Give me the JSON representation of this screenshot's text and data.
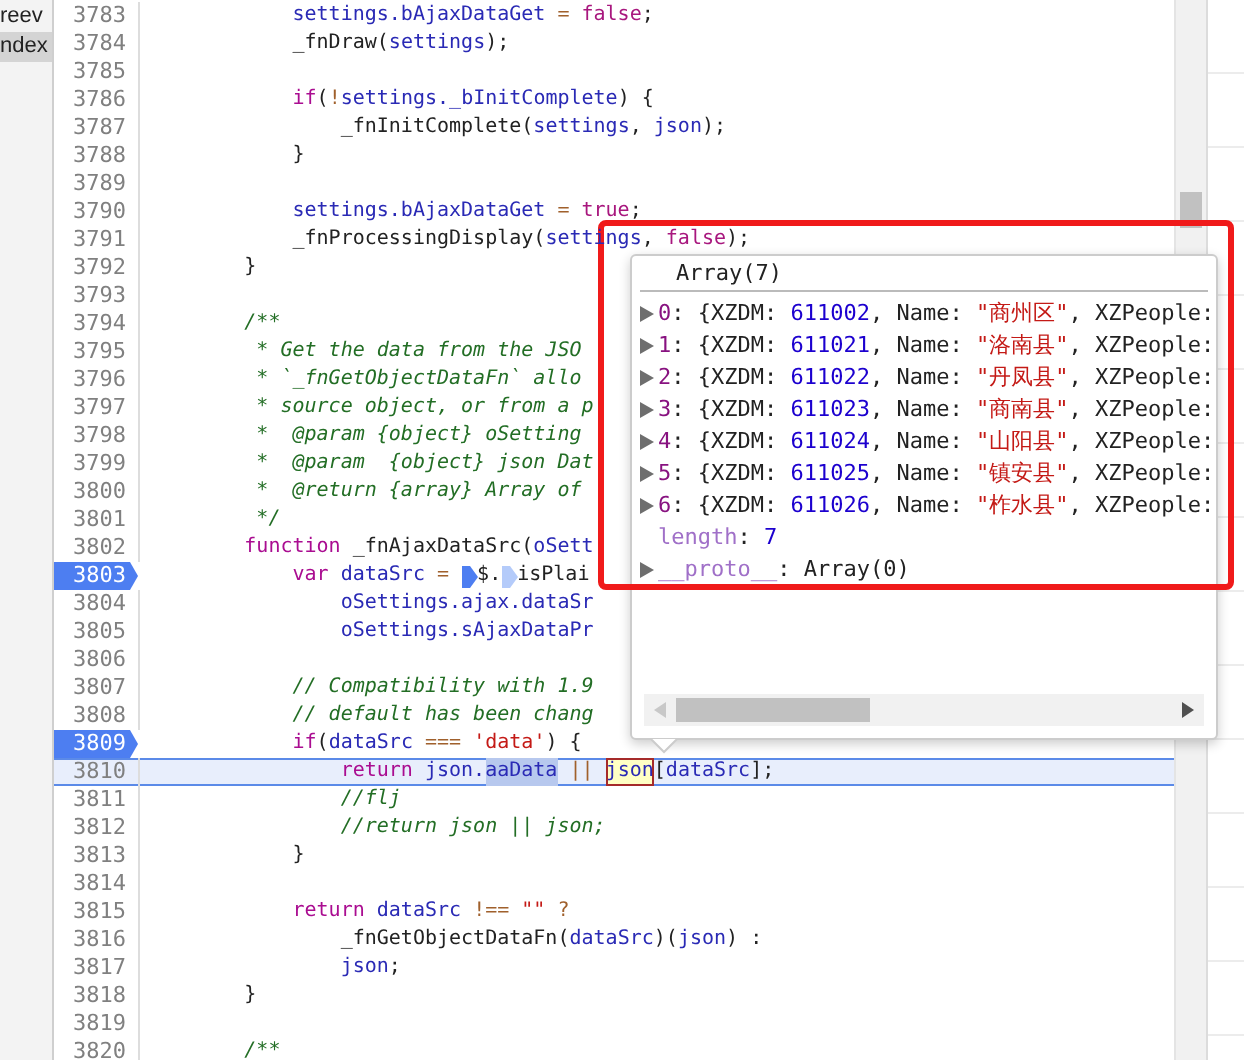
{
  "sidebar": {
    "items": [
      {
        "label": "reev",
        "selected": false
      },
      {
        "label": "ndex",
        "selected": true
      }
    ]
  },
  "editor": {
    "lines": [
      {
        "number": "3783",
        "breakpoint": false,
        "current": false,
        "tokens": [
          {
            "text": "            settings.bAjaxDataGet",
            "kind": "v"
          },
          {
            "text": " = ",
            "kind": "o"
          },
          {
            "text": "false",
            "kind": "l"
          },
          {
            "text": ";",
            "kind": "p"
          }
        ]
      },
      {
        "number": "3784",
        "breakpoint": false,
        "current": false,
        "tokens": [
          {
            "text": "            _fnDraw",
            "kind": "f"
          },
          {
            "text": "(",
            "kind": "p"
          },
          {
            "text": "settings",
            "kind": "v"
          },
          {
            "text": ");",
            "kind": "p"
          }
        ]
      },
      {
        "number": "3785",
        "breakpoint": false,
        "current": false
      },
      {
        "number": "3786",
        "breakpoint": false,
        "current": false,
        "tokens": [
          {
            "text": "            if",
            "kind": "k"
          },
          {
            "text": "(",
            "kind": "p"
          },
          {
            "text": "!",
            "kind": "o"
          },
          {
            "text": "settings._bInitComplete",
            "kind": "v"
          },
          {
            "text": ") {",
            "kind": "p"
          }
        ]
      },
      {
        "number": "3787",
        "breakpoint": false,
        "current": false,
        "tokens": [
          {
            "text": "                _fnInitComplete",
            "kind": "f"
          },
          {
            "text": "(",
            "kind": "p"
          },
          {
            "text": "settings",
            "kind": "v"
          },
          {
            "text": ", ",
            "kind": "p"
          },
          {
            "text": "json",
            "kind": "v"
          },
          {
            "text": ");",
            "kind": "p"
          }
        ]
      },
      {
        "number": "3788",
        "breakpoint": false,
        "current": false,
        "tokens": [
          {
            "text": "            }",
            "kind": "p"
          }
        ]
      },
      {
        "number": "3789",
        "breakpoint": false,
        "current": false
      },
      {
        "number": "3790",
        "breakpoint": false,
        "current": false,
        "tokens": [
          {
            "text": "            settings.bAjaxDataGet",
            "kind": "v"
          },
          {
            "text": " = ",
            "kind": "o"
          },
          {
            "text": "true",
            "kind": "l"
          },
          {
            "text": ";",
            "kind": "p"
          }
        ]
      },
      {
        "number": "3791",
        "breakpoint": false,
        "current": false,
        "tokens": [
          {
            "text": "            _fnProcessingDisplay",
            "kind": "f"
          },
          {
            "text": "(",
            "kind": "p"
          },
          {
            "text": "settings",
            "kind": "v"
          },
          {
            "text": ", ",
            "kind": "p"
          },
          {
            "text": "false",
            "kind": "l"
          },
          {
            "text": ");",
            "kind": "p"
          }
        ]
      },
      {
        "number": "3792",
        "breakpoint": false,
        "current": false,
        "tokens": [
          {
            "text": "        }",
            "kind": "p"
          }
        ]
      },
      {
        "number": "3793",
        "breakpoint": false,
        "current": false
      },
      {
        "number": "3794",
        "breakpoint": false,
        "current": false,
        "tokens": [
          {
            "text": "        /**",
            "kind": "c"
          }
        ]
      },
      {
        "number": "3795",
        "breakpoint": false,
        "current": false,
        "tokens": [
          {
            "text": "         * Get the data from the JSO",
            "kind": "c"
          }
        ]
      },
      {
        "number": "3796",
        "breakpoint": false,
        "current": false,
        "tokens": [
          {
            "text": "         * `_fnGetObjectDataFn` allo",
            "kind": "c"
          }
        ]
      },
      {
        "number": "3797",
        "breakpoint": false,
        "current": false,
        "tokens": [
          {
            "text": "         * source object, or from a p",
            "kind": "c"
          }
        ]
      },
      {
        "number": "3798",
        "breakpoint": false,
        "current": false,
        "tokens": [
          {
            "text": "         *  @param {object} oSetting",
            "kind": "c"
          }
        ]
      },
      {
        "number": "3799",
        "breakpoint": false,
        "current": false,
        "tokens": [
          {
            "text": "         *  @param  {object} json Dat",
            "kind": "c"
          }
        ]
      },
      {
        "number": "3800",
        "breakpoint": false,
        "current": false,
        "tokens": [
          {
            "text": "         *  @return {array} Array of",
            "kind": "c"
          }
        ]
      },
      {
        "number": "3801",
        "breakpoint": false,
        "current": false,
        "tokens": [
          {
            "text": "         */",
            "kind": "c"
          }
        ]
      },
      {
        "number": "3802",
        "breakpoint": false,
        "current": false,
        "tokens": [
          {
            "text": "        function",
            "kind": "k"
          },
          {
            "text": " _fnAjaxDataSrc",
            "kind": "f"
          },
          {
            "text": "(",
            "kind": "p"
          },
          {
            "text": "oSett",
            "kind": "v"
          }
        ]
      },
      {
        "number": "3803",
        "breakpoint": true,
        "current": false,
        "tokens": [
          {
            "text": "            var",
            "kind": "k"
          },
          {
            "text": " dataSrc",
            "kind": "v"
          },
          {
            "text": " = ",
            "kind": "o"
          },
          {
            "text": "$.",
            "kind": "p",
            "marker": true,
            "marker_active": true
          },
          {
            "text": "isPlai",
            "kind": "f",
            "marker": true,
            "marker_active": false
          }
        ]
      },
      {
        "number": "3804",
        "breakpoint": false,
        "current": false,
        "tokens": [
          {
            "text": "                oSettings.ajax.dataSr",
            "kind": "v"
          }
        ]
      },
      {
        "number": "3805",
        "breakpoint": false,
        "current": false,
        "tokens": [
          {
            "text": "                oSettings.sAjaxDataPr",
            "kind": "v"
          }
        ]
      },
      {
        "number": "3806",
        "breakpoint": false,
        "current": false
      },
      {
        "number": "3807",
        "breakpoint": false,
        "current": false,
        "tokens": [
          {
            "text": "            // Compatibility with 1.9",
            "kind": "c"
          }
        ]
      },
      {
        "number": "3808",
        "breakpoint": false,
        "current": false,
        "tokens": [
          {
            "text": "            // default has been chang",
            "kind": "c"
          }
        ]
      },
      {
        "number": "3809",
        "breakpoint": true,
        "current": false,
        "tokens": [
          {
            "text": "            if",
            "kind": "k"
          },
          {
            "text": "(",
            "kind": "p"
          },
          {
            "text": "dataSrc",
            "kind": "v"
          },
          {
            "text": " === ",
            "kind": "o"
          },
          {
            "text": "'data'",
            "kind": "s"
          },
          {
            "text": ") {",
            "kind": "p"
          }
        ]
      },
      {
        "number": "3810",
        "breakpoint": false,
        "current": true,
        "tokens": [
          {
            "text": "                return",
            "kind": "k"
          },
          {
            "text": " json.",
            "kind": "v"
          },
          {
            "text": "aaData",
            "kind": "v",
            "selected": true
          },
          {
            "text": " || ",
            "kind": "o"
          },
          {
            "text": "json",
            "kind": "v",
            "hovered": true
          },
          {
            "text": "[",
            "kind": "p"
          },
          {
            "text": "dataSrc",
            "kind": "v"
          },
          {
            "text": "];",
            "kind": "p"
          }
        ]
      },
      {
        "number": "3811",
        "breakpoint": false,
        "current": false,
        "tokens": [
          {
            "text": "                //flj",
            "kind": "c"
          }
        ]
      },
      {
        "number": "3812",
        "breakpoint": false,
        "current": false,
        "tokens": [
          {
            "text": "                //return json || json;",
            "kind": "c"
          }
        ]
      },
      {
        "number": "3813",
        "breakpoint": false,
        "current": false,
        "tokens": [
          {
            "text": "            }",
            "kind": "p"
          }
        ]
      },
      {
        "number": "3814",
        "breakpoint": false,
        "current": false
      },
      {
        "number": "3815",
        "breakpoint": false,
        "current": false,
        "tokens": [
          {
            "text": "            return",
            "kind": "k"
          },
          {
            "text": " dataSrc",
            "kind": "v"
          },
          {
            "text": " !== ",
            "kind": "o"
          },
          {
            "text": "\"\"",
            "kind": "s"
          },
          {
            "text": " ?",
            "kind": "o"
          }
        ]
      },
      {
        "number": "3816",
        "breakpoint": false,
        "current": false,
        "tokens": [
          {
            "text": "                _fnGetObjectDataFn",
            "kind": "f"
          },
          {
            "text": "(",
            "kind": "p"
          },
          {
            "text": "dataSrc",
            "kind": "v"
          },
          {
            "text": ")(",
            "kind": "p"
          },
          {
            "text": "json",
            "kind": "v"
          },
          {
            "text": ") :",
            "kind": "p"
          }
        ]
      },
      {
        "number": "3817",
        "breakpoint": false,
        "current": false,
        "tokens": [
          {
            "text": "                json",
            "kind": "v"
          },
          {
            "text": ";",
            "kind": "p"
          }
        ]
      },
      {
        "number": "3818",
        "breakpoint": false,
        "current": false,
        "tokens": [
          {
            "text": "        }",
            "kind": "p"
          }
        ]
      },
      {
        "number": "3819",
        "breakpoint": false,
        "current": false
      },
      {
        "number": "3820",
        "breakpoint": false,
        "current": false,
        "tokens": [
          {
            "text": "        /**",
            "kind": "c"
          }
        ]
      }
    ]
  },
  "popover": {
    "title": "Array(7)",
    "entries": [
      {
        "expanded": false,
        "tokens": [
          {
            "text": "0",
            "kind": "i"
          },
          {
            "text": ": {XZDM: ",
            "kind": "p"
          },
          {
            "text": "611002",
            "kind": "n"
          },
          {
            "text": ", Name: ",
            "kind": "p"
          },
          {
            "text": "\"商州区\"",
            "kind": "s"
          },
          {
            "text": ", XZPeople:",
            "kind": "p"
          }
        ]
      },
      {
        "expanded": false,
        "tokens": [
          {
            "text": "1",
            "kind": "i"
          },
          {
            "text": ": {XZDM: ",
            "kind": "p"
          },
          {
            "text": "611021",
            "kind": "n"
          },
          {
            "text": ", Name: ",
            "kind": "p"
          },
          {
            "text": "\"洛南县\"",
            "kind": "s"
          },
          {
            "text": ", XZPeople:",
            "kind": "p"
          }
        ]
      },
      {
        "expanded": false,
        "tokens": [
          {
            "text": "2",
            "kind": "i"
          },
          {
            "text": ": {XZDM: ",
            "kind": "p"
          },
          {
            "text": "611022",
            "kind": "n"
          },
          {
            "text": ", Name: ",
            "kind": "p"
          },
          {
            "text": "\"丹凤县\"",
            "kind": "s"
          },
          {
            "text": ", XZPeople:",
            "kind": "p"
          }
        ]
      },
      {
        "expanded": false,
        "tokens": [
          {
            "text": "3",
            "kind": "i"
          },
          {
            "text": ": {XZDM: ",
            "kind": "p"
          },
          {
            "text": "611023",
            "kind": "n"
          },
          {
            "text": ", Name: ",
            "kind": "p"
          },
          {
            "text": "\"商南县\"",
            "kind": "s"
          },
          {
            "text": ", XZPeople:",
            "kind": "p"
          }
        ]
      },
      {
        "expanded": false,
        "tokens": [
          {
            "text": "4",
            "kind": "i"
          },
          {
            "text": ": {XZDM: ",
            "kind": "p"
          },
          {
            "text": "611024",
            "kind": "n"
          },
          {
            "text": ", Name: ",
            "kind": "p"
          },
          {
            "text": "\"山阳县\"",
            "kind": "s"
          },
          {
            "text": ", XZPeople:",
            "kind": "p"
          }
        ]
      },
      {
        "expanded": false,
        "tokens": [
          {
            "text": "5",
            "kind": "i"
          },
          {
            "text": ": {XZDM: ",
            "kind": "p"
          },
          {
            "text": "611025",
            "kind": "n"
          },
          {
            "text": ", Name: ",
            "kind": "p"
          },
          {
            "text": "\"镇安县\"",
            "kind": "s"
          },
          {
            "text": ", XZPeople:",
            "kind": "p"
          }
        ]
      },
      {
        "expanded": false,
        "tokens": [
          {
            "text": "6",
            "kind": "i"
          },
          {
            "text": ": {XZDM: ",
            "kind": "p"
          },
          {
            "text": "611026",
            "kind": "n"
          },
          {
            "text": ", Name: ",
            "kind": "p"
          },
          {
            "text": "\"柞水县\"",
            "kind": "s"
          },
          {
            "text": ", XZPeople:",
            "kind": "p"
          }
        ]
      }
    ],
    "length": {
      "tokens": [
        {
          "text": "length",
          "kind": "key"
        },
        {
          "text": ": ",
          "kind": "p"
        },
        {
          "text": "7",
          "kind": "n"
        }
      ]
    },
    "proto": {
      "expanded": false,
      "tokens": [
        {
          "text": "__proto__",
          "kind": "key"
        },
        {
          "text": ": Array(0)",
          "kind": "p"
        }
      ]
    }
  }
}
